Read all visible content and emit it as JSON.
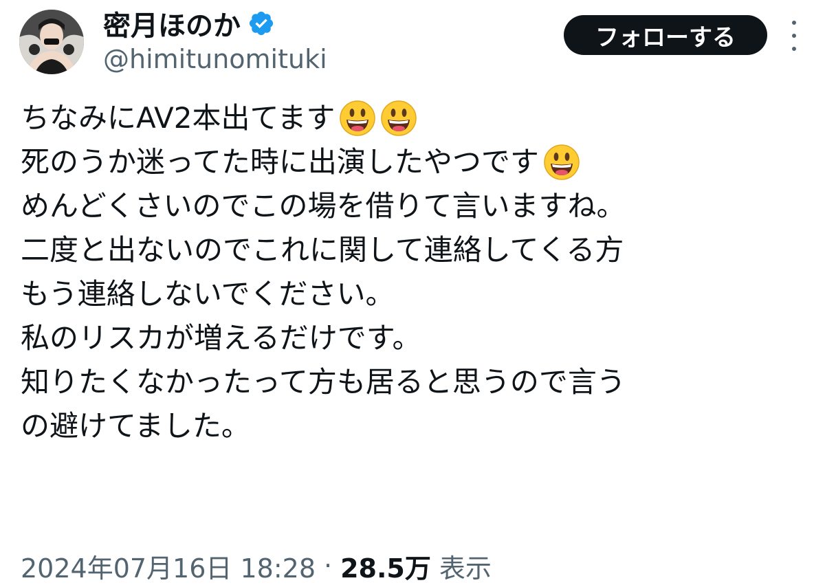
{
  "user": {
    "display_name": "密月ほのか",
    "handle": "@himitunomituki",
    "verified": true,
    "verified_icon": "verified-badge-icon",
    "avatar_icon": "profile-photo"
  },
  "actions": {
    "follow_label": "フォローする",
    "more_icon": "more-vertical-icon"
  },
  "tweet": {
    "lines": [
      "ちなみにAV2本出てます",
      "死のうか迷ってた時に出演したやつです",
      "めんどくさいのでこの場を借りて言いますね。",
      "二度と出ないのでこれに関して連絡してくる方",
      "もう連絡しないでください。",
      "私のリスカが増えるだけです。",
      "知りたくなかったって方も居ると思うので言う",
      "の避けてました。"
    ],
    "emoji": "smiley-face-emoji"
  },
  "meta": {
    "timestamp": "2024年07月16日 18:28",
    "separator": "·",
    "views_count": "28.5万",
    "views_label": "表示"
  },
  "colors": {
    "text_primary": "#0f1419",
    "text_secondary": "#536471",
    "verified_blue": "#1d9bf0",
    "follow_bg": "#0f1419"
  }
}
